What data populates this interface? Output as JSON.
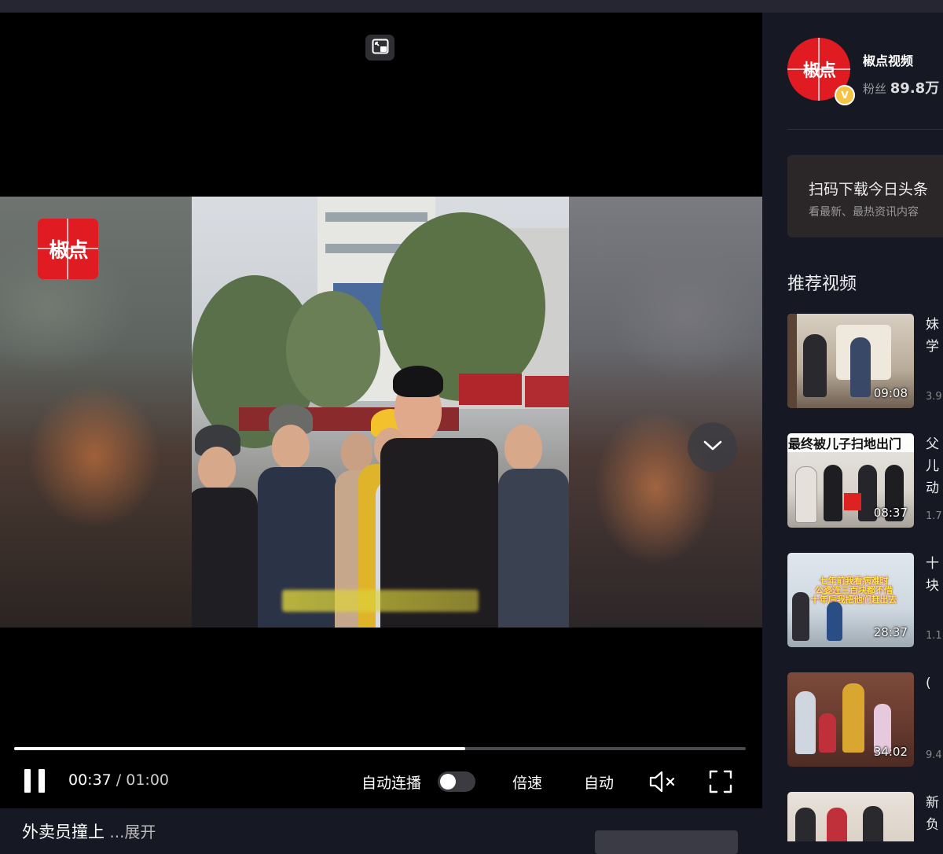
{
  "player": {
    "watermark": "椒点",
    "current_time": "00:37",
    "time_separator": " / ",
    "duration": "01:00",
    "progress": 0.617,
    "autoplay_label": "自动连播",
    "autoplay_on": false,
    "speed_label": "倍速",
    "quality_label": "自动"
  },
  "video_title": {
    "text": "外卖员撞上",
    "expand_label": " ...展开"
  },
  "author": {
    "avatar_text": "椒点",
    "verified_mark": "V",
    "name": "椒点视频",
    "fans_label": "粉丝 ",
    "fans_count": "89.8万"
  },
  "download_card": {
    "title": "扫码下载今日头条",
    "subtitle": "看最新、最热资讯内容"
  },
  "recommended": {
    "heading": "推荐视频",
    "items": [
      {
        "duration": "09:08",
        "title_line1": "妹",
        "title_line2": "学",
        "meta": "3.9",
        "thumb_caption": "",
        "thumb_text": ""
      },
      {
        "duration": "08:37",
        "title_line1": "父",
        "title_line2": "儿",
        "title_line3": "动",
        "meta": "1.7",
        "thumb_caption": "最终被儿子扫地出门",
        "thumb_text": ""
      },
      {
        "duration": "28:37",
        "title_line1": "十",
        "title_line2": "块",
        "meta": "1.1",
        "thumb_caption": "",
        "thumb_text": "七年前我看病难时\n公婆连三百块都不借\n十年后我把他们赶出去"
      },
      {
        "duration": "34:02",
        "title_line1": "(",
        "title_line2": "",
        "meta": "9.4",
        "thumb_caption": "",
        "thumb_text": ""
      },
      {
        "duration": "",
        "title_line1": "新",
        "title_line2": "负",
        "meta": "",
        "thumb_caption": "",
        "thumb_text": ""
      }
    ]
  },
  "colors": {
    "accent_red": "#e01b22",
    "background": "#161823",
    "verify_gold": "#f6c343"
  }
}
